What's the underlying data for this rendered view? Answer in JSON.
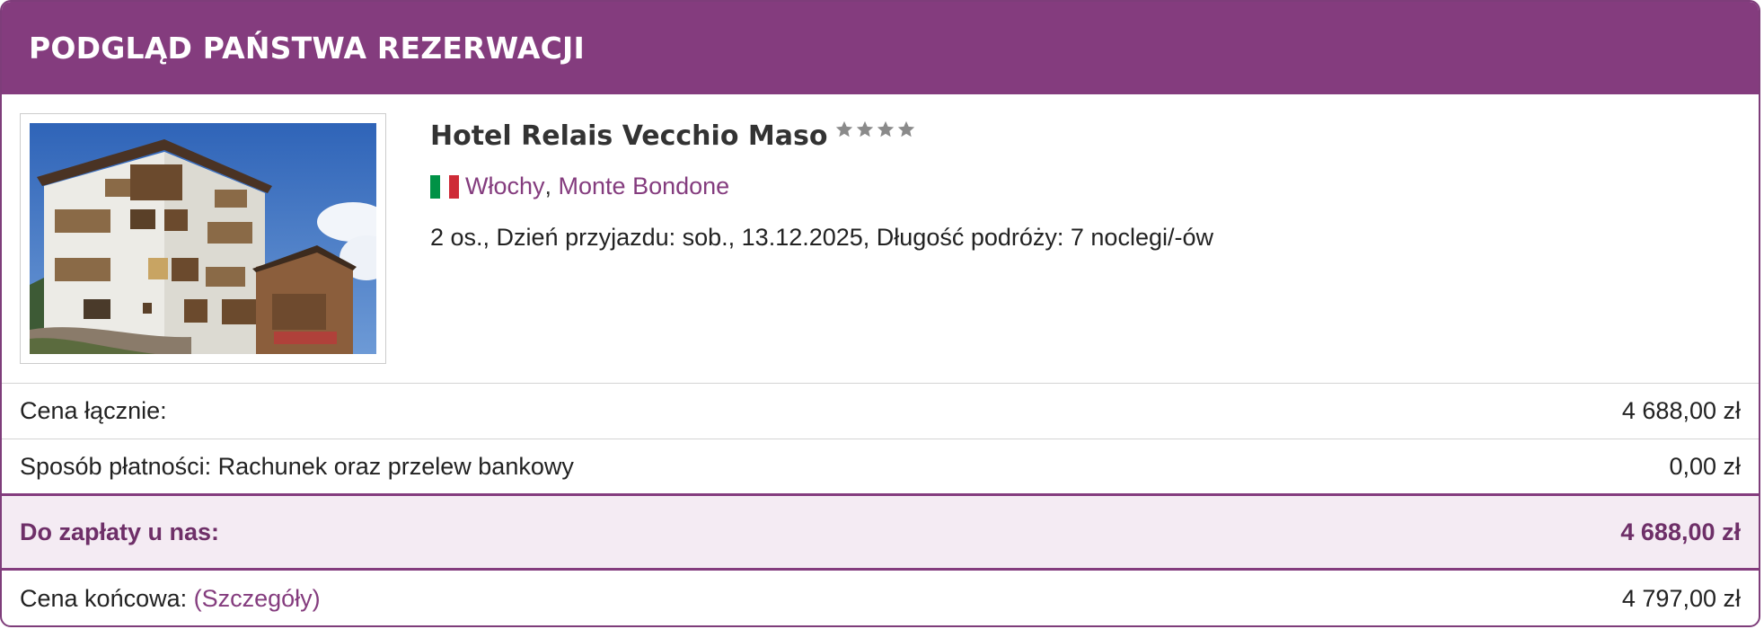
{
  "header": {
    "title": "PODGLĄD PAŃSTWA REZERWACJI"
  },
  "hotel": {
    "name": "Hotel Relais Vecchio Maso",
    "stars": 4,
    "star_color": "#8a8a8a",
    "country": "Włochy",
    "region": "Monte Bondone",
    "flag_colors": [
      "#009246",
      "#ffffff",
      "#ce2b37"
    ],
    "trip_details": "2 os., Dzień przyjazdu: sob., 13.12.2025, Długość podróży: 7 noclegi/-ów"
  },
  "summary": {
    "total_label": "Cena łącznie:",
    "total_value": "4 688,00 zł",
    "payment_label": "Sposób płatności: Rachunek oraz przelew bankowy",
    "payment_value": "0,00 zł",
    "due_label": "Do zapłaty u nas:",
    "due_value": "4 688,00 zł",
    "final_label": "Cena końcowa: ",
    "final_details_link": "(Szczegóły)",
    "final_value": "4 797,00 zł"
  },
  "colors": {
    "accent": "#843c7e",
    "highlight_bg": "#f4ebf3"
  }
}
